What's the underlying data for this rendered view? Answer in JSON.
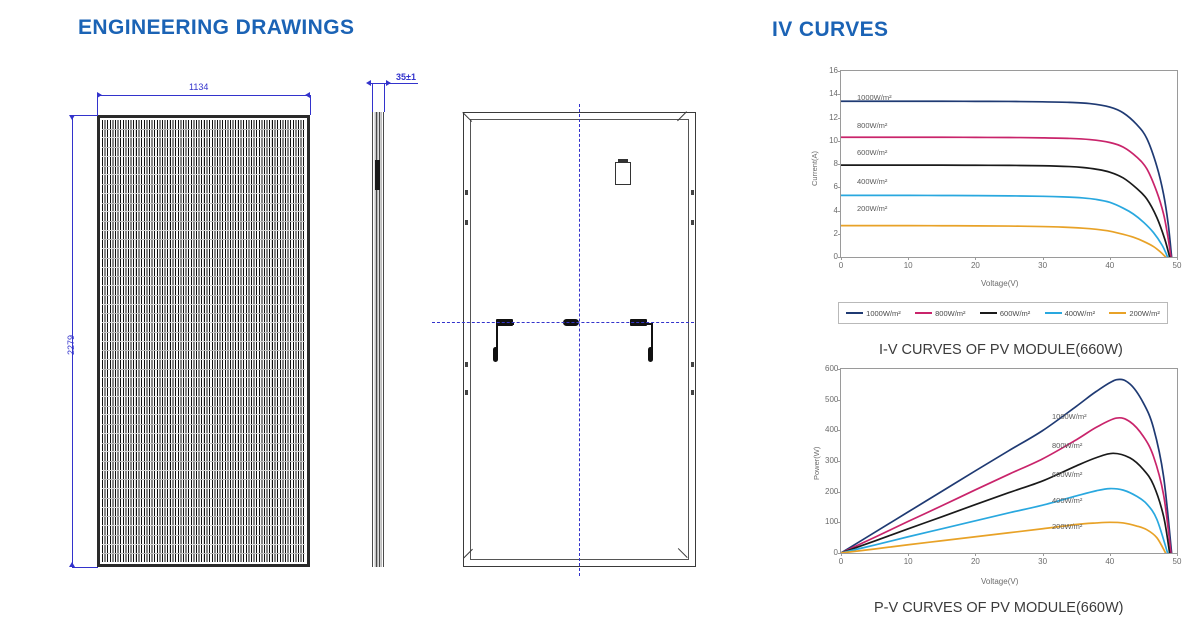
{
  "headings": {
    "engineering": "ENGINEERING DRAWINGS",
    "iv": "IV CURVES"
  },
  "drawing": {
    "width_dim": "1134",
    "height_dim": "2279",
    "thickness_dim": "35±1",
    "views": {
      "front": "front-view",
      "side": "side-view",
      "back": "back-view"
    }
  },
  "series_colors": {
    "s1000": "#1f3a73",
    "s800": "#c9246b",
    "s600": "#1a1a1a",
    "s400": "#29a8df",
    "s200": "#e8a227"
  },
  "legend": {
    "items": [
      {
        "label": "1000W/m²",
        "color": "#1f3a73"
      },
      {
        "label": "800W/m²",
        "color": "#c9246b"
      },
      {
        "label": "600W/m²",
        "color": "#1a1a1a"
      },
      {
        "label": "400W/m²",
        "color": "#29a8df"
      },
      {
        "label": "200W/m²",
        "color": "#e8a227"
      }
    ]
  },
  "chart_data": [
    {
      "type": "line",
      "id": "iv-chart",
      "title": "I-V CURVES OF PV MODULE(660W)",
      "xlabel": "Voltage(V)",
      "ylabel": "Current(A)",
      "xlim": [
        0,
        50
      ],
      "ylim": [
        0,
        16
      ],
      "xticks": [
        0,
        10,
        20,
        30,
        40,
        50
      ],
      "yticks": [
        0,
        2,
        4,
        6,
        8,
        10,
        12,
        14,
        16
      ],
      "grid": false,
      "legend_position": "below",
      "annotations": [
        "1000W/m²",
        "800W/m²",
        "600W/m²",
        "400W/m²",
        "200W/m²"
      ],
      "series": [
        {
          "name": "1000W/m²",
          "color": "#1f3a73",
          "isc": 13.4,
          "x": [
            0,
            5,
            10,
            15,
            20,
            25,
            30,
            34,
            37,
            40,
            42,
            44,
            45.5,
            47,
            48,
            48.7,
            49.2
          ],
          "values": [
            13.4,
            13.4,
            13.4,
            13.4,
            13.39,
            13.38,
            13.35,
            13.3,
            13.2,
            12.9,
            12.4,
            11.4,
            10.2,
            7.8,
            5.4,
            2.8,
            0
          ]
        },
        {
          "name": "800W/m²",
          "color": "#c9246b",
          "isc": 10.3,
          "x": [
            0,
            5,
            10,
            15,
            20,
            25,
            30,
            34,
            37,
            40,
            42,
            44,
            45.5,
            47,
            48,
            48.6,
            49.1
          ],
          "values": [
            10.3,
            10.3,
            10.3,
            10.3,
            10.29,
            10.28,
            10.25,
            10.2,
            10.1,
            9.85,
            9.45,
            8.6,
            7.6,
            5.6,
            3.7,
            1.9,
            0
          ]
        },
        {
          "name": "600W/m²",
          "color": "#1a1a1a",
          "isc": 7.9,
          "x": [
            0,
            5,
            10,
            15,
            20,
            25,
            30,
            34,
            36,
            38,
            40,
            42,
            44,
            45.5,
            47,
            48.2,
            48.9
          ],
          "values": [
            7.9,
            7.9,
            7.9,
            7.9,
            7.89,
            7.88,
            7.85,
            7.78,
            7.7,
            7.55,
            7.3,
            6.8,
            5.9,
            5.0,
            3.4,
            1.5,
            0
          ]
        },
        {
          "name": "400W/m²",
          "color": "#29a8df",
          "isc": 5.3,
          "x": [
            0,
            5,
            10,
            15,
            20,
            25,
            30,
            33,
            36,
            38,
            40,
            42,
            43.5,
            45,
            46.5,
            47.8,
            48.6
          ],
          "values": [
            5.3,
            5.3,
            5.3,
            5.29,
            5.28,
            5.26,
            5.22,
            5.17,
            5.08,
            4.95,
            4.7,
            4.2,
            3.7,
            3.0,
            2.1,
            1.0,
            0
          ]
        },
        {
          "name": "200W/m²",
          "color": "#e8a227",
          "isc": 2.7,
          "x": [
            0,
            5,
            10,
            15,
            20,
            25,
            30,
            33,
            36,
            38,
            40,
            42,
            43.5,
            45,
            46.5,
            47.6,
            48.3
          ],
          "values": [
            2.7,
            2.7,
            2.7,
            2.69,
            2.68,
            2.66,
            2.62,
            2.57,
            2.48,
            2.38,
            2.22,
            1.95,
            1.7,
            1.35,
            0.9,
            0.4,
            0
          ]
        }
      ]
    },
    {
      "type": "line",
      "id": "pv-chart",
      "title": "P-V CURVES OF PV MODULE(660W)",
      "xlabel": "Voltage(V)",
      "ylabel": "Power(W)",
      "xlim": [
        0,
        50
      ],
      "ylim": [
        0,
        600
      ],
      "xticks": [
        0,
        10,
        20,
        30,
        40,
        50
      ],
      "yticks": [
        0,
        100,
        200,
        300,
        400,
        500,
        600
      ],
      "grid": false,
      "legend_position": "inline",
      "annotations": [
        "1000W/m²",
        "800W/m²",
        "600W/m²",
        "400W/m²",
        "200W/m²"
      ],
      "series": [
        {
          "name": "1000W/m²",
          "color": "#1f3a73",
          "pmax": 565,
          "vmp": 41,
          "x": [
            0,
            5,
            10,
            15,
            20,
            25,
            30,
            35,
            38,
            41,
            43,
            45,
            46.5,
            48,
            49.2
          ],
          "values": [
            0,
            67,
            134,
            201,
            268,
            334,
            399,
            478,
            527,
            565,
            551,
            489,
            408,
            250,
            0
          ]
        },
        {
          "name": "800W/m²",
          "color": "#c9246b",
          "pmax": 440,
          "vmp": 41,
          "x": [
            0,
            5,
            10,
            15,
            20,
            25,
            30,
            35,
            38,
            41,
            43,
            45,
            46.5,
            48,
            49.1
          ],
          "values": [
            0,
            51,
            103,
            154,
            206,
            257,
            307,
            369,
            410,
            440,
            428,
            380,
            315,
            190,
            0
          ]
        },
        {
          "name": "600W/m²",
          "color": "#1a1a1a",
          "pmax": 325,
          "vmp": 40.5,
          "x": [
            0,
            5,
            10,
            15,
            20,
            25,
            30,
            35,
            38,
            40.5,
            43,
            45,
            46.5,
            48,
            48.9
          ],
          "values": [
            0,
            39,
            79,
            118,
            158,
            197,
            235,
            284,
            311,
            325,
            310,
            272,
            222,
            120,
            0
          ]
        },
        {
          "name": "400W/m²",
          "color": "#29a8df",
          "pmax": 210,
          "vmp": 40,
          "x": [
            0,
            5,
            10,
            15,
            20,
            25,
            30,
            35,
            38,
            40,
            42,
            44,
            45.5,
            47,
            48.6
          ],
          "values": [
            0,
            26,
            53,
            79,
            105,
            131,
            156,
            186,
            203,
            210,
            205,
            185,
            160,
            110,
            0
          ]
        },
        {
          "name": "200W/m²",
          "color": "#e8a227",
          "pmax": 100,
          "vmp": 40,
          "x": [
            0,
            5,
            10,
            15,
            20,
            25,
            30,
            35,
            38,
            40,
            42,
            44,
            45.5,
            47,
            48.3
          ],
          "values": [
            0,
            13,
            27,
            40,
            53,
            66,
            79,
            93,
            98,
            100,
            98,
            88,
            76,
            50,
            0
          ]
        }
      ]
    }
  ]
}
